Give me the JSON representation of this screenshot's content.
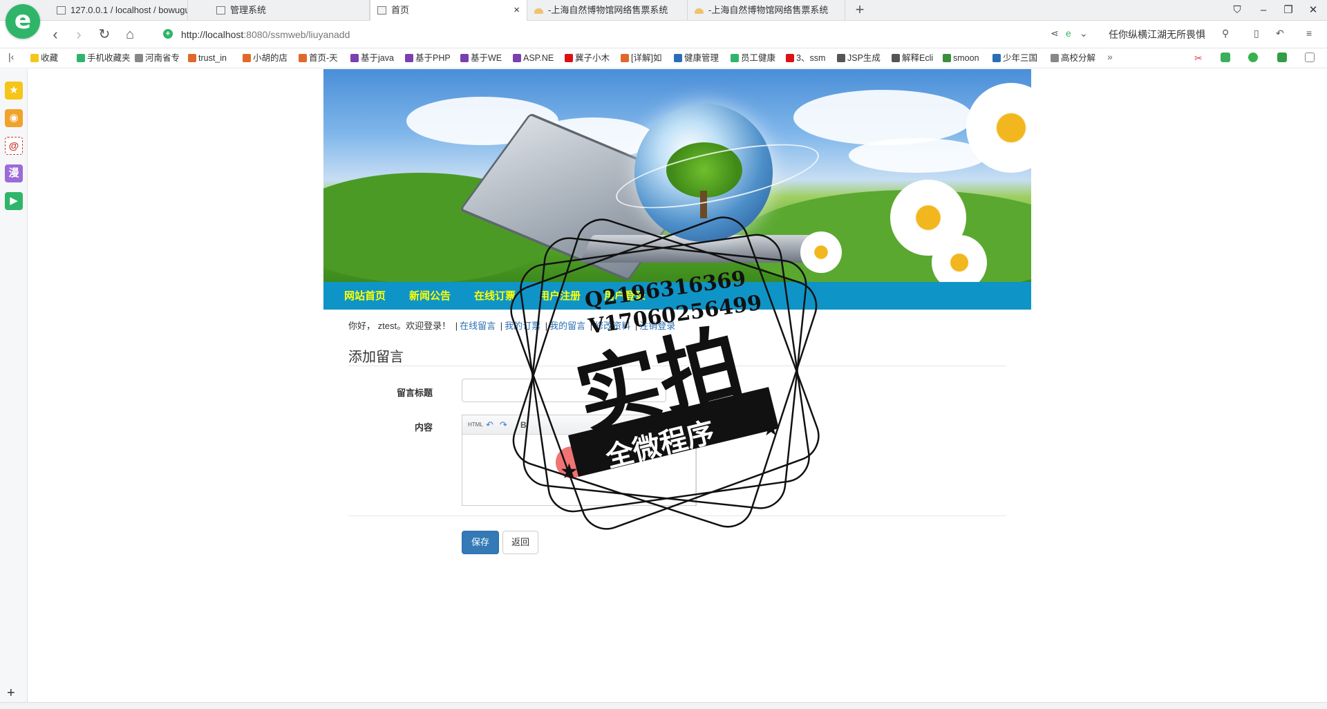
{
  "browser": {
    "logo": "e",
    "tabs": [
      {
        "label": "127.0.0.1 / localhost / bowugu"
      },
      {
        "label": "管理系统"
      },
      {
        "label": "首页"
      },
      {
        "label": "-上海自然博物馆网络售票系统"
      },
      {
        "label": "-上海自然博物馆网络售票系统"
      }
    ],
    "new_tab": "+",
    "url_host": "http://localhost",
    "url_rest": ":8080/ssmweb/liuyanadd",
    "search_text": "任你纵横江湖无所畏惧",
    "bookmarks": [
      "收藏",
      "手机收藏夹",
      "河南省专",
      "trust_in",
      "小胡的店",
      "首页-天",
      "基于java",
      "基于PHP",
      "基于WE",
      "ASP.NE",
      "冀子小木",
      "[详解]如",
      "健康管理",
      "员工健康",
      "3、ssm",
      "JSP生成",
      "解释Ecli",
      "smoon",
      "少年三国",
      "高校分解"
    ],
    "more": "»"
  },
  "site": {
    "nav": [
      "网站首页",
      "新闻公告",
      "在线订票",
      "用户注册",
      "用户登录"
    ],
    "welcome_prefix": "你好， ztest。欢迎登录！",
    "user_links": [
      "在线留言",
      "我的订票",
      "我的留言",
      "修改资料",
      "注销登录"
    ],
    "form_title": "添加留言",
    "field_title_label": "留言标题",
    "field_content_label": "内容",
    "editor_toolbar": [
      "HTML",
      "↶",
      "↷",
      "B"
    ],
    "save_label": "保存",
    "back_label": "返回"
  },
  "watermark": {
    "line1": "Q2196316369",
    "line2": "V17060256499",
    "main": "实拍",
    "sub": "全微程序"
  }
}
